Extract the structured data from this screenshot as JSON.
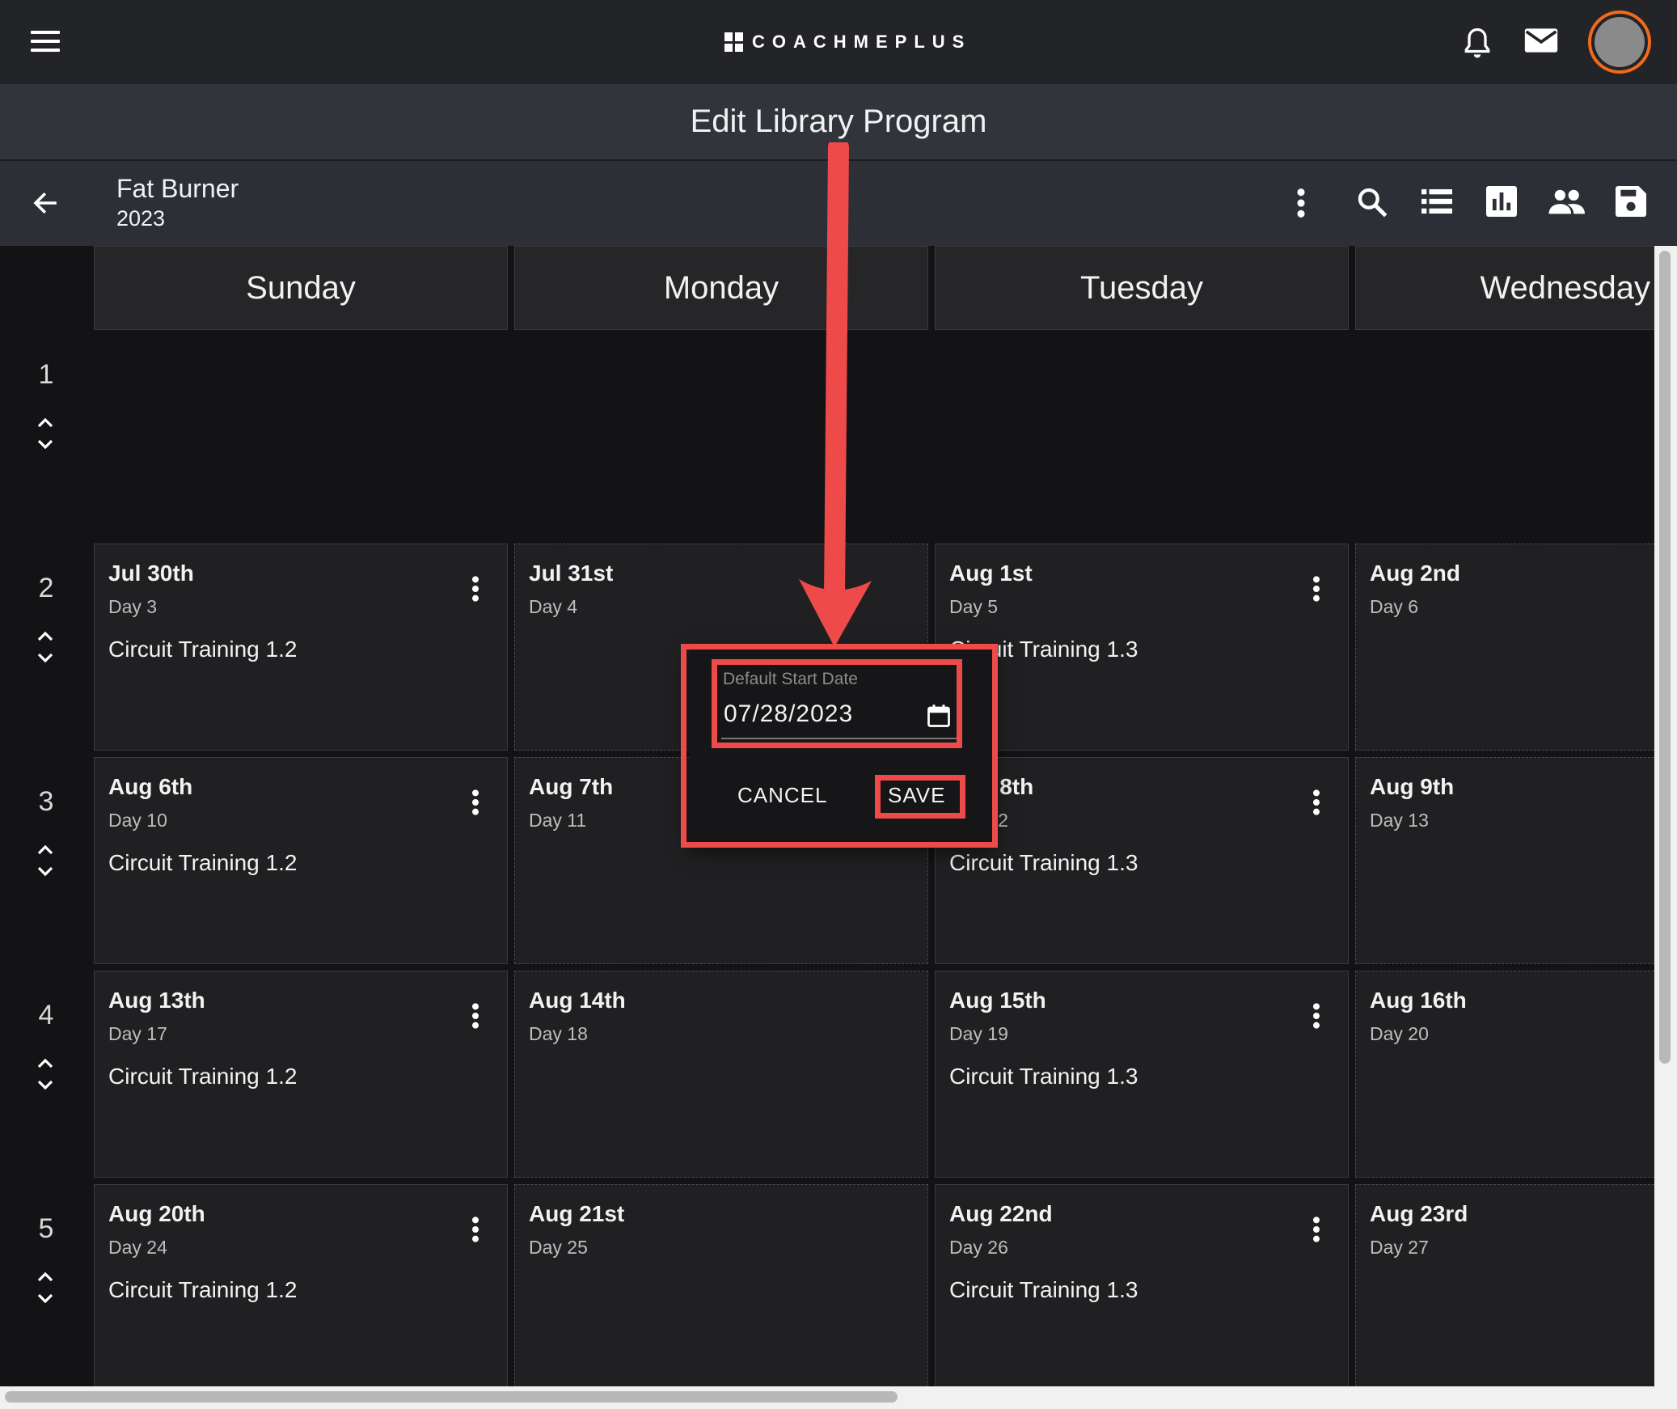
{
  "app": {
    "brand": "COACHMEPLUS"
  },
  "header": {
    "page_title": "Edit Library Program"
  },
  "program": {
    "name": "Fat Burner",
    "year": "2023"
  },
  "calendar": {
    "day_headers": [
      "Sunday",
      "Monday",
      "Tuesday",
      "Wednesday"
    ],
    "weeks": [
      {
        "number": "1",
        "cells": []
      },
      {
        "number": "2",
        "cells": [
          {
            "date": "Jul 30th",
            "day": "Day 3",
            "workout": "Circuit Training 1.2",
            "has_menu": true
          },
          {
            "date": "Jul 31st",
            "day": "Day 4",
            "workout": "",
            "has_menu": false
          },
          {
            "date": "Aug 1st",
            "day": "Day 5",
            "workout": "Circuit Training 1.3",
            "has_menu": true
          },
          {
            "date": "Aug 2nd",
            "day": "Day 6",
            "workout": "",
            "has_menu": false
          }
        ]
      },
      {
        "number": "3",
        "cells": [
          {
            "date": "Aug 6th",
            "day": "Day 10",
            "workout": "Circuit Training 1.2",
            "has_menu": true
          },
          {
            "date": "Aug 7th",
            "day": "Day 11",
            "workout": "",
            "has_menu": false
          },
          {
            "date": "Aug 8th",
            "day": "Day 12",
            "workout": "Circuit Training 1.3",
            "has_menu": true
          },
          {
            "date": "Aug 9th",
            "day": "Day 13",
            "workout": "",
            "has_menu": false
          }
        ]
      },
      {
        "number": "4",
        "cells": [
          {
            "date": "Aug 13th",
            "day": "Day 17",
            "workout": "Circuit Training 1.2",
            "has_menu": true
          },
          {
            "date": "Aug 14th",
            "day": "Day 18",
            "workout": "",
            "has_menu": false
          },
          {
            "date": "Aug 15th",
            "day": "Day 19",
            "workout": "Circuit Training 1.3",
            "has_menu": true
          },
          {
            "date": "Aug 16th",
            "day": "Day 20",
            "workout": "",
            "has_menu": false
          }
        ]
      },
      {
        "number": "5",
        "cells": [
          {
            "date": "Aug 20th",
            "day": "Day 24",
            "workout": "Circuit Training 1.2",
            "has_menu": true
          },
          {
            "date": "Aug 21st",
            "day": "Day 25",
            "workout": "",
            "has_menu": false
          },
          {
            "date": "Aug 22nd",
            "day": "Day 26",
            "workout": "Circuit Training 1.3",
            "has_menu": true
          },
          {
            "date": "Aug 23rd",
            "day": "Day 27",
            "workout": "",
            "has_menu": false
          }
        ]
      }
    ]
  },
  "dialog": {
    "field_label": "Default Start Date",
    "field_value": "07/28/2023",
    "cancel_label": "CANCEL",
    "save_label": "SAVE"
  },
  "colors": {
    "accent_orange": "#f26a1b",
    "annotation_red": "#ee4a4a"
  },
  "icons": {
    "top_right": [
      "bell-icon",
      "mail-icon",
      "avatar"
    ],
    "toolbar": [
      "more-vert-icon",
      "search-icon",
      "list-icon",
      "bar-chart-icon",
      "people-icon",
      "save-icon"
    ]
  }
}
